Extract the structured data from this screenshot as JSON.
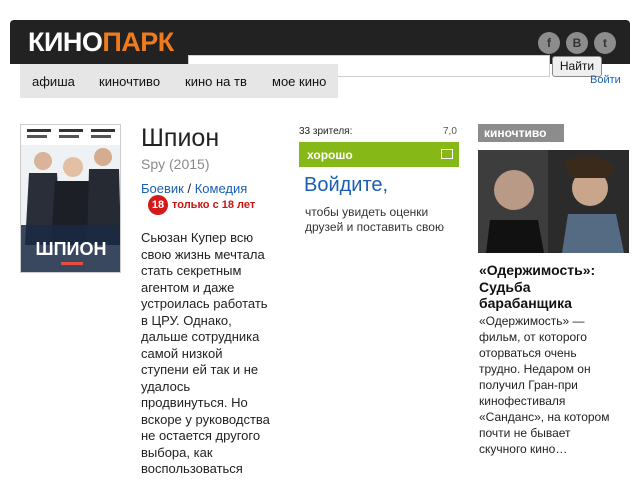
{
  "logo": {
    "part1": "КИНО",
    "part2": "ПАРК"
  },
  "colors": {
    "logo_accent": "#f07b1c",
    "link": "#1a5fb4",
    "rating_green": "#86b817",
    "age_red": "#d21a1a",
    "topbar": "#222222"
  },
  "social": {
    "facebook": "f",
    "vk": "B",
    "twitter": "t"
  },
  "search": {
    "value": "",
    "button_label": "Найти",
    "login_label": "Войти"
  },
  "nav": {
    "items": [
      "афиша",
      "киночтиво",
      "кино на тв",
      "мое кино"
    ]
  },
  "movie": {
    "title": "Шпион",
    "original_title": "Spy (2015)",
    "genres": [
      "Боевик",
      "Комедия"
    ],
    "genre_separator": "/",
    "age_badge": "18",
    "age_text": "только с 18 лет",
    "description": "Сьюзан Купер всю свою жизнь мечтала стать секретным агентом и даже устроилась работать в ЦРУ. Однако, дальше сотрудника самой низкой ступени ей так и не удалось продвинуться. Но вскоре у руководства не остается другого выбора, как воспользоваться"
  },
  "rating": {
    "viewers": "33 зрителя:",
    "value": "7,0",
    "label": "хорошо",
    "signin_link": "Войдите,",
    "signin_note": "чтобы увидеть оценки друзей и поставить свою"
  },
  "sidebar": {
    "section": "киночтиво",
    "article_title": "«Одержимость»: Судьба барабанщика",
    "article_text": "«Одержимость» — фильм, от которого оторваться очень трудно. Недаром он получил Гран-при кинофестиваля «Санданс», на котором почти не бывает скучного кино…"
  }
}
